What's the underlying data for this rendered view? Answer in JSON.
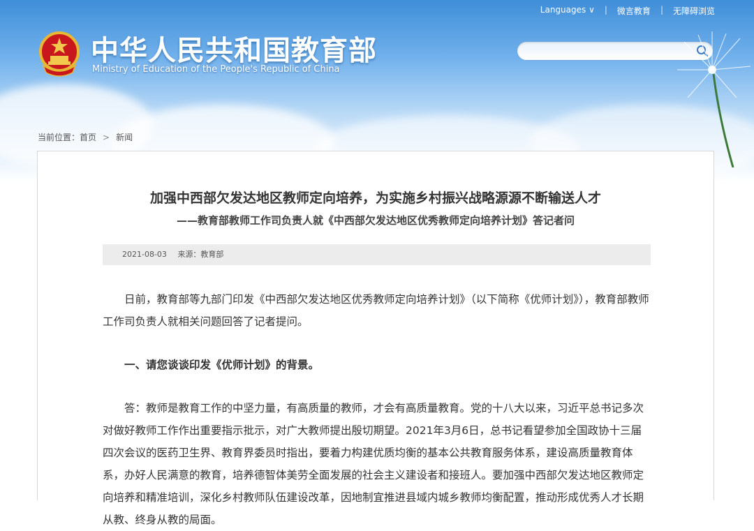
{
  "header": {
    "title_cn": "中华人民共和国教育部",
    "title_en": "Ministry of Education of the People's Republic of China",
    "links": [
      "Languages ∨",
      "微言教育",
      "无障碍浏览"
    ]
  },
  "breadcrumb": {
    "label": "当前位置：",
    "home": "首页",
    "separator": ">",
    "current": "新闻"
  },
  "article": {
    "title": "加强中西部欠发达地区教师定向培养，为实施乡村振兴战略源源不断输送人才",
    "subtitle": "——教育部教师工作司负责人就《中西部欠发达地区优秀教师定向培养计划》答记者问",
    "date": "2021-08-03",
    "source": "来源：教育部",
    "paragraphs": [
      "日前，教育部等九部门印发《中西部欠发达地区优秀教师定向培养计划》（以下简称《优师计划》），教育部教师工作司负责人就相关问题回答了记者提问。",
      "一、请您谈谈印发《优师计划》的背景。",
      "答：教师是教育工作的中坚力量，有高质量的教师，才会有高质量教育。党的十八大以来，习近平总书记多次对做好教师工作作出重要指示批示，对广大教师提出殷切期望。2021年3月6日，总书记看望参加全国政协十三届四次会议的医药卫生界、教育界委员时指出，要着力构建优质均衡的基本公共教育服务体系，建设高质量教育体系，办好人民满意的教育，培养德智体美劳全面发展的社会主义建设者和接班人。要加强中西部欠发达地区教师定向培养和精准培训，深化乡村教师队伍建设改革，因地制宜推进县域内城乡教师均衡配置，推动形成优秀人才长期从教、终身从教的局面。"
    ]
  },
  "colors": {
    "header_blue": "#3f8ed8",
    "meta_bg": "#ececec",
    "text": "#333333"
  }
}
